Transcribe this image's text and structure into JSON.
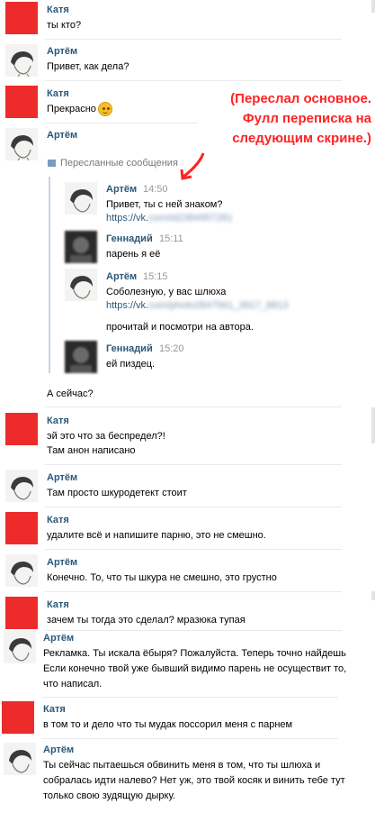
{
  "messages": [
    {
      "author": "Катя",
      "lines": [
        "ты кто?"
      ]
    },
    {
      "author": "Артём",
      "lines": [
        "Привет, как дела?"
      ]
    },
    {
      "author": "Катя",
      "lines": [
        "Прекрасно"
      ],
      "emoji": "smile-emoji"
    },
    {
      "author": "Артём",
      "forwarded_label": "Пересланные сообщения",
      "after_forward": "А сейчас?"
    },
    {
      "author": "Катя",
      "lines": [
        "эй это что за беспредел?!",
        "Там анон написано"
      ]
    },
    {
      "author": "Артём",
      "lines": [
        "Там просто шкуродетект стоит"
      ]
    },
    {
      "author": "Катя",
      "lines": [
        "удалите всё и напишите парню, это не смешно."
      ]
    },
    {
      "author": "Артём",
      "lines": [
        "Конечно. То, что ты шкура не смешно, это грустно"
      ]
    },
    {
      "author": "Катя",
      "lines": [
        "зачем ты тогда это сделал? мразюка тупая"
      ]
    },
    {
      "author": "Артём",
      "lines": [
        "Рекламка. Ты искала ёбыря? Пожалуйста. Теперь точно найдешь",
        "Если конечно твой уже бывший видимо парень не осуществит то,",
        "что написал."
      ]
    },
    {
      "author": "Катя",
      "lines": [
        "в том то и дело что ты мудак поссорил меня с парнем"
      ]
    },
    {
      "author": "Артём",
      "lines": [
        "Ты сейчас пытаешься обвинить меня в том, что ты шлюха и",
        "собралась идти налево? Нет уж, это твой косяк и винить тебе тут",
        "только свою зудящую дырку."
      ]
    }
  ],
  "forwarded": [
    {
      "author": "Артём",
      "time": "14:50",
      "lines": [
        "Привет, ты с ней знаком?"
      ],
      "link_prefix": "https://vk.",
      "link_blur": "com/id2384957281"
    },
    {
      "author": "Геннадий",
      "time": "15:11",
      "lines": [
        "парень я её"
      ]
    },
    {
      "author": "Артём",
      "time": "15:15",
      "lines": [
        "Соболезную, у вас шлюха"
      ],
      "link_prefix": "https://vk.",
      "link_blur": "com/photo2847561_3917_8813",
      "extra": "прочитай и посмотри на автора."
    },
    {
      "author": "Геннадий",
      "time": "15:20",
      "lines": [
        "ей пиздец."
      ]
    }
  ],
  "annotation": [
    "(Переслал основное.",
    "Фулл переписка на",
    "следующим скрине.)"
  ],
  "colors": {
    "name": "#2b587a",
    "red_avatar": "#ee2b2b",
    "annotation": "#ff2222",
    "separator": "#e7ebef"
  }
}
